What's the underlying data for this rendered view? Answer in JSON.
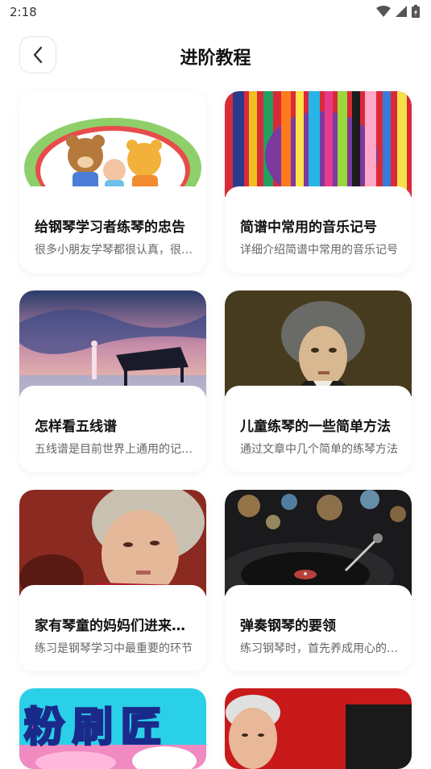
{
  "status": {
    "time": "2:18"
  },
  "header": {
    "title": "进阶教程"
  },
  "cards": [
    {
      "title": "给钢琴学习者练琴的忠告",
      "desc": "很多小朋友学琴都很认真，很多家长"
    },
    {
      "title": "简谱中常用的音乐记号",
      "desc": "详细介绍简谱中常用的音乐记号"
    },
    {
      "title": "怎样看五线谱",
      "desc": "五线谱是目前世界上通用的记谱法"
    },
    {
      "title": "儿童练琴的一些简单方法",
      "desc": "通过文章中几个简单的练琴方法"
    },
    {
      "title": "家有琴童的妈妈们进来看看",
      "desc": "练习是钢琴学习中最重要的环节"
    },
    {
      "title": "弹奏钢琴的要领",
      "desc": "练习钢琴时，首先养成用心的习惯"
    }
  ],
  "partial_cards": [
    {
      "banner_text": "粉刷匠"
    },
    {
      "banner_text": ""
    }
  ]
}
